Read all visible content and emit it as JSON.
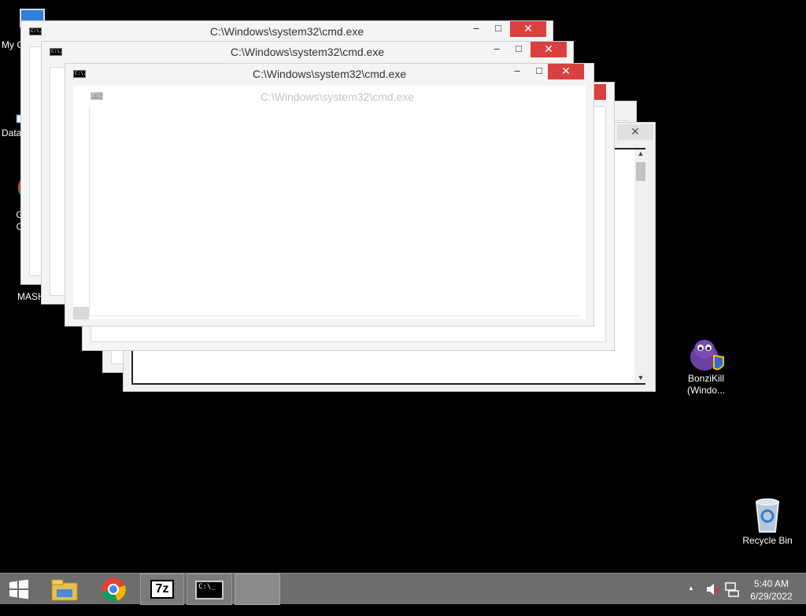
{
  "desktop": {
    "icons": {
      "my_computer": "My C",
      "data": "Data",
      "chrome_line1": "G",
      "chrome_line2": "C",
      "mash": "MASH",
      "bonzikill_line1": "BonziKill",
      "bonzikill_line2": "(Windo...",
      "recycle_bin": "Recycle Bin"
    }
  },
  "windows": {
    "w1": {
      "title": "C:\\Windows\\system32\\cmd.exe"
    },
    "w2": {
      "title": "C:\\Windows\\system32\\cmd.exe"
    },
    "w3": {
      "title": "C:\\Windows\\system32\\cmd.exe"
    },
    "w4": {
      "title": "C:\\Windows\\system32\\cmd.exe"
    }
  },
  "window_buttons": {
    "minimize": "–",
    "maximize": "□",
    "close": "✕"
  },
  "cmd_icon_text": "C:\\.",
  "taskbar": {
    "start_icon": "windows-logo-icon",
    "pinned": [
      "file-explorer-icon",
      "chrome-icon",
      "7zip-icon",
      "cmd-icon"
    ],
    "seven_zip_label": "7z",
    "cmd_label": "C:\\_"
  },
  "tray": {
    "time": "5:40 AM",
    "date": "6/29/2022",
    "overflow": "▲",
    "icons": [
      "volume-muted-icon",
      "network-icon"
    ]
  },
  "colors": {
    "desktop_bg": "#000000",
    "close_button": "#d94040",
    "taskbar_bg": "#6d6d6d"
  }
}
